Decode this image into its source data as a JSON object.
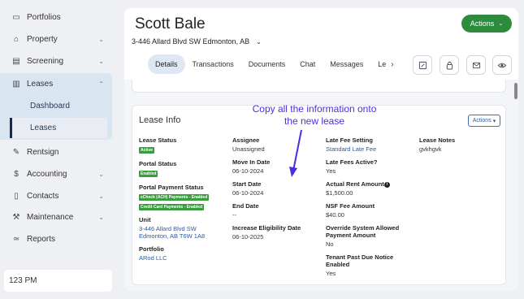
{
  "sidebar": {
    "items": [
      {
        "label": "Portfolios",
        "icon": "folder-icon",
        "glyph": "▭"
      },
      {
        "label": "Property",
        "icon": "building-icon",
        "glyph": "⌂"
      },
      {
        "label": "Screening",
        "icon": "document-search-icon",
        "glyph": "▤"
      },
      {
        "label": "Leases",
        "icon": "clipboard-icon",
        "glyph": "▥"
      },
      {
        "label": "Rentsign",
        "icon": "pen-icon",
        "glyph": "✎"
      },
      {
        "label": "Accounting",
        "icon": "dollar-icon",
        "glyph": "$"
      },
      {
        "label": "Contacts",
        "icon": "contacts-book-icon",
        "glyph": "▯"
      },
      {
        "label": "Maintenance",
        "icon": "wrench-icon",
        "glyph": "⚒"
      },
      {
        "label": "Reports",
        "icon": "chart-icon",
        "glyph": "≃"
      }
    ],
    "leases_sub": {
      "dashboard": "Dashboard",
      "leases": "Leases"
    },
    "time_text": "123 PM"
  },
  "header": {
    "name": "Scott Bale",
    "address": "3-446 Allard Blvd SW Edmonton, AB",
    "actions_label": "Actions"
  },
  "tabs": [
    "Details",
    "Transactions",
    "Documents",
    "Chat",
    "Messages",
    "Le"
  ],
  "icon_buttons": [
    "edit-icon",
    "lock-icon",
    "mail-icon",
    "eye-icon"
  ],
  "lease_info": {
    "title": "Lease Info",
    "actions_label": "Actions",
    "col1": {
      "lease_status_label": "Lease Status",
      "lease_status_badge": "Active",
      "portal_status_label": "Portal Status",
      "portal_status_badge": "Enabled",
      "payment_status_label": "Portal Payment Status",
      "payment_badge_1": "eCheck (ACH) Payments - Enabled",
      "payment_badge_2": "Credit Card Payments - Enabled",
      "unit_label": "Unit",
      "unit_line1": "3-446 Allard Blvd SW",
      "unit_line2": "Edmonton, AB T6W 1A8",
      "portfolio_label": "Portfolio",
      "portfolio_value": "ARod LLC"
    },
    "col2": {
      "assignee_label": "Assignee",
      "assignee_value": "Unassigned",
      "move_in_label": "Move In Date",
      "move_in_value": "06-10-2024",
      "start_label": "Start Date",
      "start_value": "06-10-2024",
      "end_label": "End Date",
      "end_value": "--",
      "increase_label": "Increase Eligibility Date",
      "increase_value": "06-10-2025"
    },
    "col3": {
      "late_fee_label": "Late Fee Setting",
      "late_fee_value": "Standard Late Fee",
      "late_active_label": "Late Fees Active?",
      "late_active_value": "Yes",
      "rent_label": "Actual Rent Amount",
      "rent_value": "$1,500.00",
      "nsf_label": "NSF Fee Amount",
      "nsf_value": "$40.00",
      "override_label_1": "Override System Allowed",
      "override_label_2": "Payment Amount",
      "override_value": "No",
      "past_due_label_1": "Tenant Past Due Notice",
      "past_due_label_2": "Enabled",
      "past_due_value": "Yes"
    },
    "col4": {
      "notes_label": "Lease Notes",
      "notes_value": "gvkhgvk"
    }
  },
  "annotation": {
    "line1": "Copy all the information onto",
    "line2": "the new lease"
  },
  "colors": {
    "accent_green": "#2e8b3e",
    "link_blue": "#2c5aa0",
    "annotation_purple": "#4b2ee3"
  }
}
